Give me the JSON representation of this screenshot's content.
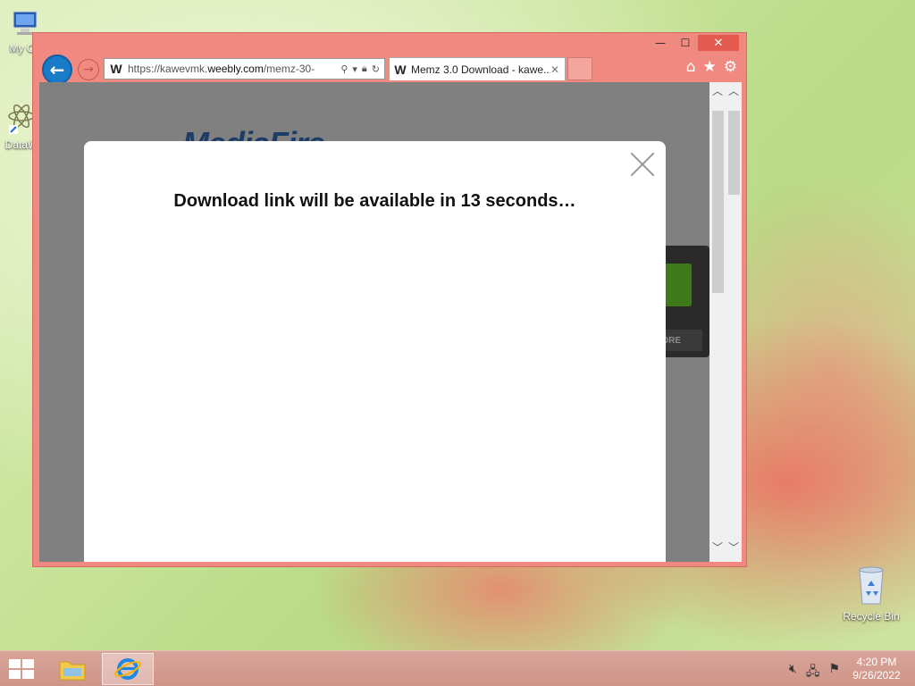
{
  "desktop": {
    "icons": [
      {
        "label": "My Co"
      },
      {
        "label": "DataW"
      },
      {
        "label": "Recycle Bin"
      }
    ]
  },
  "browser": {
    "address_url_prefix": "https://kawevmk.",
    "address_url_domain": "weebly.com",
    "address_url_path": "/memz-30-",
    "tab_title": "Memz 3.0 Download - kawe...",
    "tab_close": "✕",
    "window": {
      "minimize": "—",
      "maximize": "☐",
      "close": "✕"
    },
    "page": {
      "logo_text": "MediaFire",
      "more_button": "ORE"
    },
    "modal": {
      "message": "Download link will be available in 13 seconds…"
    }
  },
  "taskbar": {
    "time": "4:20 PM",
    "date": "9/26/2022"
  }
}
